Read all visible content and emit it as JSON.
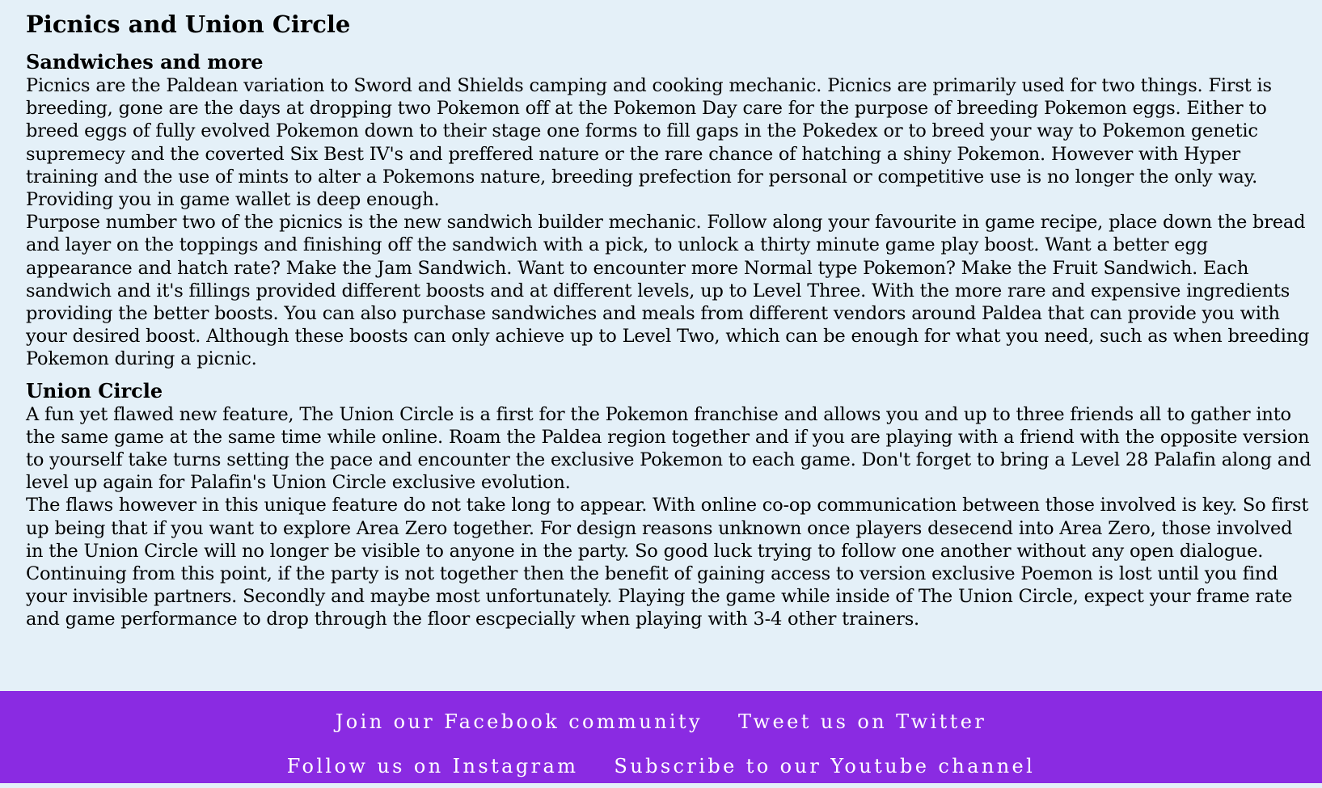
{
  "page": {
    "title": "Picnics and Union Circle"
  },
  "sections": [
    {
      "heading": "Sandwiches and more",
      "paragraphs": [
        "Picnics are the Paldean variation to Sword and Shields camping and cooking mechanic. Picnics are primarily used for two things. First is breeding, gone are the days at dropping two Pokemon off at the Pokemon Day care for the purpose of breeding Pokemon eggs. Either to breed eggs of fully evolved Pokemon down to their stage one forms to fill gaps in the Pokedex or to breed your way to Pokemon genetic supremecy and the coverted Six Best IV's and preffered nature or the rare chance of hatching a shiny Pokemon. However with Hyper training and the use of mints to alter a Pokemons nature, breeding prefection for personal or competitive use is no longer the only way. Providing you in game wallet is deep enough.",
        "Purpose number two of the picnics is the new sandwich builder mechanic. Follow along your favourite in game recipe, place down the bread and layer on the toppings and finishing off the sandwich with a pick, to unlock a thirty minute game play boost. Want a better egg appearance and hatch rate? Make the Jam Sandwich. Want to encounter more Normal type Pokemon? Make the Fruit Sandwich. Each sandwich and it's fillings provided different boosts and at different levels, up to Level Three. With the more rare and expensive ingredients providing the better boosts. You can also purchase sandwiches and meals from different vendors around Paldea that can provide you with your desired boost. Although these boosts can only achieve up to Level Two, which can be enough for what you need, such as when breeding Pokemon during a picnic."
      ]
    },
    {
      "heading": "Union Circle",
      "paragraphs": [
        "A fun yet flawed new feature, The Union Circle is a first for the Pokemon franchise and allows you and up to three friends all to gather into the same game at the same time while online. Roam the Paldea region together and if you are playing with a friend with the opposite version to yourself take turns setting the pace and encounter the exclusive Pokemon to each game. Don't forget to bring a Level 28 Palafin along and level up again for Palafin's Union Circle exclusive evolution.",
        "The flaws however in this unique feature do not take long to appear. With online co-op communication between those involved is key. So first up being that if you want to explore Area Zero together. For design reasons unknown once players desecend into Area Zero, those involved in the Union Circle will no longer be visible to anyone in the party. So good luck trying to follow one another without any open dialogue. Continuing from this point, if the party is not together then the benefit of gaining access to version exclusive Poemon is lost until you find your invisible partners. Secondly and maybe most unfortunately. Playing the game while inside of The Union Circle, expect your frame rate and game performance to drop through the floor escpecially when playing with 3-4 other trainers."
      ]
    }
  ],
  "footer": {
    "facebook": "Join our Facebook community",
    "twitter": "Tweet us on Twitter",
    "instagram": "Follow us on Instagram",
    "youtube": "Subscribe to our Youtube channel"
  },
  "colors": {
    "background": "#e4f0f8",
    "footer_background": "#8a2be2",
    "footer_text": "#ffffff"
  }
}
